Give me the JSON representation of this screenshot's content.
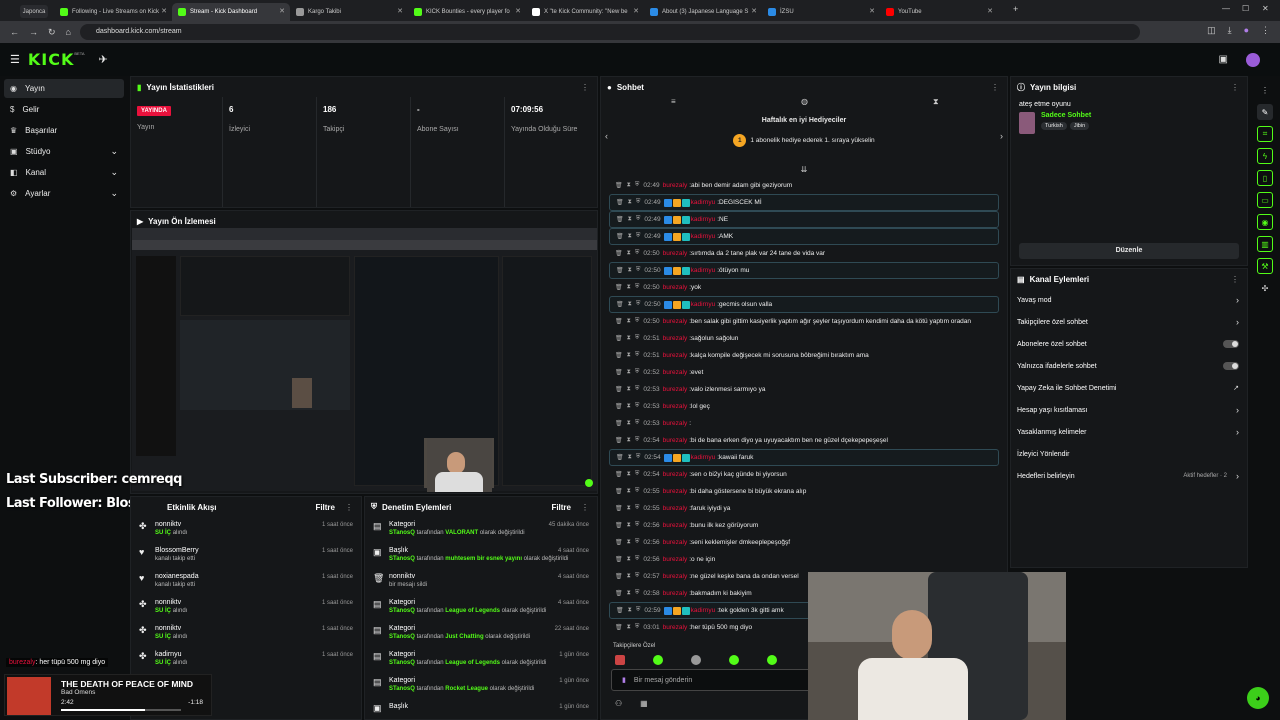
{
  "browser": {
    "tabs": [
      {
        "label": "Japonca",
        "color": "#8a8a8a"
      },
      {
        "label": "Following - Live Streams on Kick",
        "color": "#53fc18"
      },
      {
        "label": "Stream - Kick Dashboard",
        "color": "#53fc18"
      },
      {
        "label": "Kargo Takibi",
        "color": "#999999"
      },
      {
        "label": "KICK Bounties - every player fo",
        "color": "#53fc18"
      },
      {
        "label": "X \"te Kick Community: \"New be",
        "color": "#ffffff"
      },
      {
        "label": "About (3) Japanese Language S",
        "color": "#2b8be6"
      },
      {
        "label": "İZSU",
        "color": "#2b8be6"
      },
      {
        "label": "YouTube",
        "color": "#ff0000"
      }
    ],
    "url": "dashboard.kick.com/stream"
  },
  "kick": {
    "logo": "KICK",
    "beta": "BETA"
  },
  "sidebar": {
    "items": [
      {
        "label": "Yayın",
        "icon": "broadcast-icon"
      },
      {
        "label": "Gelir",
        "icon": "money-icon"
      },
      {
        "label": "Başarılar",
        "icon": "trophy-icon"
      },
      {
        "label": "Stüdyo",
        "icon": "studio-icon"
      },
      {
        "label": "Kanal",
        "icon": "channel-icon"
      },
      {
        "label": "Ayarlar",
        "icon": "gear-icon"
      }
    ]
  },
  "stats": {
    "title": "Yayın İstatistikleri",
    "live_badge": "YAYINDA",
    "items": [
      {
        "value": "",
        "label": "Yayın"
      },
      {
        "value": "6",
        "label": "İzleyici"
      },
      {
        "value": "186",
        "label": "Takipçi"
      },
      {
        "value": "-",
        "label": "Abone Sayısı"
      },
      {
        "value": "07:09:56",
        "label": "Yayında Olduğu Süre"
      }
    ]
  },
  "preview": {
    "title": "Yayın Ön İzlemesi"
  },
  "overlay": {
    "last_subscriber": "Last Subscriber: cemreqq",
    "last_follower": "Last Follower: BlossomBerry",
    "chat_pop_user": "burezaly",
    "chat_pop_msg": "her tüpü 500 mg diyo",
    "song_title": "THE DEATH OF PEACE OF MIND",
    "song_artist": "Bad Omens",
    "song_elapsed": "2:42",
    "song_remaining": "-1:18",
    "song_progress": 0.7
  },
  "activity": {
    "title": "Etkinlik Akışı",
    "filter": "Filtre",
    "items": [
      {
        "icon": "gift-icon",
        "name": "nonniktv",
        "sub": "SU İÇ",
        "sub2": "alındı",
        "time": "1 saat önce"
      },
      {
        "icon": "heart-icon",
        "name": "BlossomBerry",
        "sub": "",
        "sub2": "kanalı takip etti",
        "time": "1 saat önce"
      },
      {
        "icon": "heart-icon",
        "name": "noxianespada",
        "sub": "",
        "sub2": "kanalı takip etti",
        "time": "1 saat önce"
      },
      {
        "icon": "gift-icon",
        "name": "nonniktv",
        "sub": "SU İÇ",
        "sub2": "alındı",
        "time": "1 saat önce"
      },
      {
        "icon": "gift-icon",
        "name": "nonniktv",
        "sub": "SU İÇ",
        "sub2": "alındı",
        "time": "1 saat önce"
      },
      {
        "icon": "gift-icon",
        "name": "kadirnyu",
        "sub": "SU İÇ",
        "sub2": "alındı",
        "time": "1 saat önce"
      }
    ]
  },
  "moderation": {
    "title": "Denetim Eylemleri",
    "filter": "Filtre",
    "items": [
      {
        "icon": "category-icon",
        "name": "Kategori",
        "actor": "STanosQ",
        "mid": "tarafından",
        "target": "VALORANT",
        "tail": "olarak değiştirildi",
        "time": "45 dakika önce"
      },
      {
        "icon": "title-icon",
        "name": "Başlık",
        "actor": "STanosQ",
        "mid": "tarafından",
        "target": "muhtesem bir esnek yayını",
        "tail": "olarak değiştirildi",
        "time": "4 saat önce"
      },
      {
        "icon": "trash-icon",
        "name": "nonniktv",
        "actor": "",
        "mid": "",
        "target": "",
        "tail": "bir mesajı sildi",
        "time": "4 saat önce"
      },
      {
        "icon": "category-icon",
        "name": "Kategori",
        "actor": "STanosQ",
        "mid": "tarafından",
        "target": "League of Legends",
        "tail": "olarak değiştirildi",
        "time": "4 saat önce"
      },
      {
        "icon": "category-icon",
        "name": "Kategori",
        "actor": "STanosQ",
        "mid": "tarafından",
        "target": "Just Chatting",
        "tail": "olarak değiştirildi",
        "time": "22 saat önce"
      },
      {
        "icon": "category-icon",
        "name": "Kategori",
        "actor": "STanosQ",
        "mid": "tarafından",
        "target": "League of Legends",
        "tail": "olarak değiştirildi",
        "time": "1 gün önce"
      },
      {
        "icon": "category-icon",
        "name": "Kategori",
        "actor": "STanosQ",
        "mid": "tarafından",
        "target": "Rocket League",
        "tail": "olarak değiştirildi",
        "time": "1 gün önce"
      },
      {
        "icon": "title-icon",
        "name": "Başlık",
        "actor": "",
        "mid": "",
        "target": "",
        "tail": "",
        "time": "1 gün önce"
      }
    ]
  },
  "chat": {
    "title": "Sohbet",
    "gifters_title": "Haftalık en iyi Hediyeciler",
    "gifters_rank": "1",
    "gifters_msg": "1 abonelik hediye ederek 1. sıraya yükselin",
    "followers_only": "Takipçilere Özel",
    "input_placeholder": "Bir mesaj gönderin",
    "messages": [
      {
        "t": "02:49",
        "u": "burezaly",
        "m": "abi ben demir adam gibi geziyorum",
        "hl": false
      },
      {
        "t": "02:49",
        "u": "kadirnyu",
        "m": "DEGISCEK Mİ",
        "hl": true
      },
      {
        "t": "02:49",
        "u": "kadirnyu",
        "m": "NE",
        "hl": true
      },
      {
        "t": "02:49",
        "u": "kadirnyu",
        "m": "AMK",
        "hl": true
      },
      {
        "t": "02:50",
        "u": "burezaly",
        "m": "sırtımda da 2 tane plak var 24 tane de vida var",
        "hl": false
      },
      {
        "t": "02:50",
        "u": "kadirnyu",
        "m": "ötüyon mu",
        "hl": true
      },
      {
        "t": "02:50",
        "u": "burezaly",
        "m": "yok",
        "hl": false
      },
      {
        "t": "02:50",
        "u": "kadirnyu",
        "m": "gecmis olsun valla",
        "hl": true
      },
      {
        "t": "02:50",
        "u": "burezaly",
        "m": "ben salak gibi gittim kasiyerlik yaptım ağır şeyler taşıyordum kendimi daha da kötü yaptım oradan",
        "hl": false
      },
      {
        "t": "02:51",
        "u": "burezaly",
        "m": "sağolun sağolun",
        "hl": false
      },
      {
        "t": "02:51",
        "u": "burezaly",
        "m": "kalça kompile değişecek mi sorusuna böbreğimi bıraktım ama",
        "hl": false
      },
      {
        "t": "02:52",
        "u": "burezaly",
        "m": "evet",
        "hl": false
      },
      {
        "t": "02:53",
        "u": "burezaly",
        "m": "valo izlenmesi sarmıyo ya",
        "hl": false
      },
      {
        "t": "02:53",
        "u": "burezaly",
        "m": "lol geç",
        "hl": false
      },
      {
        "t": "02:53",
        "u": "burezaly",
        "m": "",
        "hl": false
      },
      {
        "t": "02:54",
        "u": "burezaly",
        "m": "bi de bana erken diyo ya uyuyacaktım ben ne güzel dçekepepeşeşel",
        "hl": false
      },
      {
        "t": "02:54",
        "u": "kadirnyu",
        "m": "kawaii faruk",
        "hl": true
      },
      {
        "t": "02:54",
        "u": "burezaly",
        "m": "sen o bi2yi kaç günde bi yiyorsun",
        "hl": false
      },
      {
        "t": "02:55",
        "u": "burezaly",
        "m": "bi daha göstersene bi büyük ekrana alıp",
        "hl": false
      },
      {
        "t": "02:55",
        "u": "burezaly",
        "m": "faruk iyiydi ya",
        "hl": false
      },
      {
        "t": "02:56",
        "u": "burezaly",
        "m": "bunu ilk kez görüyorum",
        "hl": false
      },
      {
        "t": "02:56",
        "u": "burezaly",
        "m": "seni keklemişler dmkeeplepeşoğşf",
        "hl": false
      },
      {
        "t": "02:56",
        "u": "burezaly",
        "m": "o ne için",
        "hl": false
      },
      {
        "t": "02:57",
        "u": "burezaly",
        "m": "ne güzel keşke bana da ondan versel",
        "hl": false
      },
      {
        "t": "02:58",
        "u": "burezaly",
        "m": "bakmadım ki bakiyim",
        "hl": false
      },
      {
        "t": "02:59",
        "u": "kadirnyu",
        "m": "tek golden 3k gitti amk",
        "hl": true
      },
      {
        "t": "03:01",
        "u": "burezaly",
        "m": "her tüpü 500 mg diyo",
        "hl": false
      }
    ]
  },
  "stream_info": {
    "title": "Yayın bilgisi",
    "stream_title": "ateş etme oyunu",
    "category": "Sadece Sohbet",
    "tags": [
      "Turkish",
      "Jibin"
    ],
    "edit_button": "Düzenle"
  },
  "channel_actions": {
    "title": "Kanal Eylemleri",
    "items": [
      {
        "label": "Yavaş mod",
        "kind": "arrow"
      },
      {
        "label": "Takipçilere özel sohbet",
        "kind": "arrow"
      },
      {
        "label": "Abonelere özel sohbet",
        "kind": "toggle"
      },
      {
        "label": "Yalnızca ifadelerle sohbet",
        "kind": "toggle"
      },
      {
        "label": "Yapay Zeka ile Sohbet Denetimi",
        "kind": "external"
      },
      {
        "label": "Hesap yaşı kısıtlaması",
        "kind": "arrow"
      },
      {
        "label": "Yasaklanmış kelimeler",
        "kind": "arrow"
      },
      {
        "label": "İzleyici Yönlendir",
        "kind": "none"
      },
      {
        "label": "Hedefleri belirleyin",
        "kind": "arrow",
        "note": "Aktif hedefler · 2"
      }
    ]
  },
  "colors": {
    "accent": "#53fc18",
    "live": "#e9113c",
    "username": "#e9113c"
  }
}
